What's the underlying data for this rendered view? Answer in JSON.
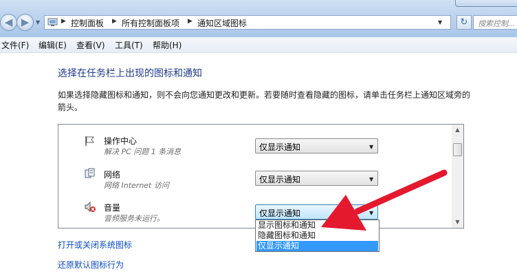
{
  "breadcrumbs": [
    "控制面板",
    "所有控制面板项",
    "通知区域图标"
  ],
  "search": {
    "placeholder": "搜索控制..."
  },
  "menu": [
    "文件(F)",
    "编辑(E)",
    "查看(V)",
    "工具(T)",
    "帮助(H)"
  ],
  "main": {
    "title": "选择在任务栏上出现的图标和通知",
    "description": "如果选择隐藏图标和通知，则不会向您通知更改和更新。若要随时查看隐藏的图标，请单击任务栏上通知区域旁的箭头。",
    "items": [
      {
        "name": "操作中心",
        "subtitle": "解决 PC 问题 1 条消息",
        "value": "仅显示通知",
        "icon": "flag-icon"
      },
      {
        "name": "网络",
        "subtitle": "网络 Internet 访问",
        "value": "仅显示通知",
        "icon": "network-icon"
      },
      {
        "name": "音量",
        "subtitle": "音频服务未运行。",
        "value": "仅显示通知",
        "icon": "speaker-muted-icon"
      }
    ],
    "dropdown_options": [
      "显示图标和通知",
      "隐藏图标和通知",
      "仅显示通知"
    ],
    "links": [
      "打开或关闭系统图标",
      "还原默认图标行为"
    ]
  },
  "colors": {
    "annotation_arrow": "#e4192e",
    "selection": "#3399ff",
    "link": "#0b4cc4",
    "heading": "#1e3a8c"
  }
}
